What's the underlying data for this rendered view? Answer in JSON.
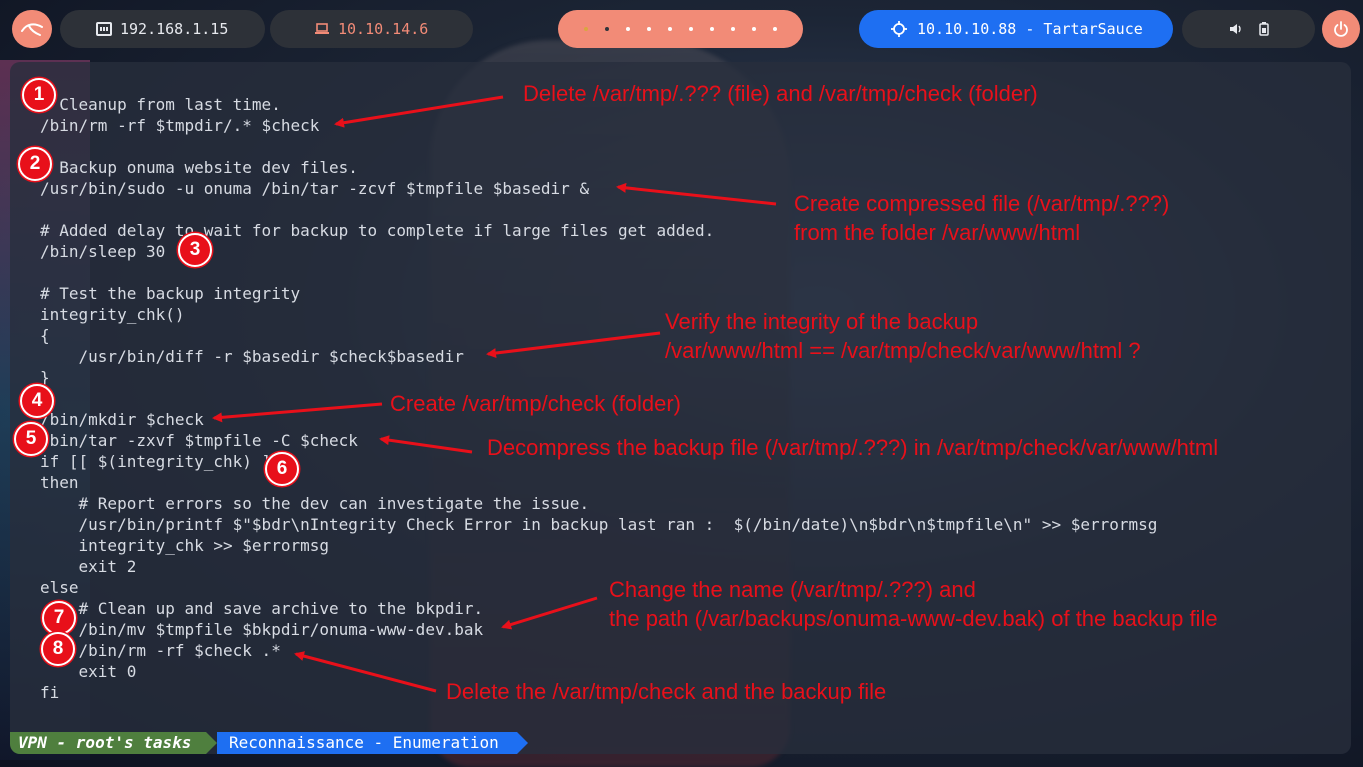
{
  "taskbar": {
    "ip_local": "192.168.1.15",
    "ip_vpn": "10.10.14.6",
    "target": "10.10.10.88 - TartarSauce"
  },
  "terminal": {
    "code_lines": [
      "# Cleanup from last time.",
      "/bin/rm -rf $tmpdir/.* $check",
      "",
      "# Backup onuma website dev files.",
      "/usr/bin/sudo -u onuma /bin/tar -zcvf $tmpfile $basedir &",
      "",
      "# Added delay to wait for backup to complete if large files get added.",
      "/bin/sleep 30",
      "",
      "# Test the backup integrity",
      "integrity_chk()",
      "{",
      "    /usr/bin/diff -r $basedir $check$basedir",
      "}",
      "",
      "/bin/mkdir $check",
      "/bin/tar -zxvf $tmpfile -C $check",
      "if [[ $(integrity_chk) ]]",
      "then",
      "    # Report errors so the dev can investigate the issue.",
      "    /usr/bin/printf $\"$bdr\\nIntegrity Check Error in backup last ran :  $(/bin/date)\\n$bdr\\n$tmpfile\\n\" >> $errormsg",
      "    integrity_chk >> $errormsg",
      "    exit 2",
      "else",
      "    # Clean up and save archive to the bkpdir.",
      "    /bin/mv $tmpfile $bkpdir/onuma-www-dev.bak",
      "    /bin/rm -rf $check .*",
      "    exit 0",
      "fi"
    ],
    "status_left": "VPN - root's tasks",
    "status_right": "Reconnaissance - Enumeration"
  },
  "annotations": {
    "badges": [
      "1",
      "2",
      "3",
      "4",
      "5",
      "6",
      "7",
      "8"
    ],
    "notes": {
      "delete_files": "Delete /var/tmp/.???   (file)    and     /var/tmp/check   (folder)",
      "compress_1": "Create compressed file (/var/tmp/.???)",
      "compress_2": "from the folder /var/www/html",
      "verify_1": "Verify the integrity of the backup",
      "verify_2": "/var/www/html   ==   /var/tmp/check/var/www/html ?",
      "create_check": "Create /var/tmp/check   (folder)",
      "decompress": "Decompress the backup file (/var/tmp/.???)   in   /var/tmp/check/var/www/html",
      "rename_1": "Change the name (/var/tmp/.???) and",
      "rename_2": "the path (/var/backups/onuma-www-dev.bak) of the backup file",
      "delete_check": "Delete the /var/tmp/check and the backup file"
    }
  },
  "colors": {
    "annotation": "#e8101a",
    "accent": "#f28b77",
    "target_blue": "#1e6ff2",
    "status_green": "#4f7f3e"
  },
  "icons": [
    "kali-dragon-icon",
    "ethernet-icon",
    "laptop-icon",
    "crosshair-icon",
    "speaker-icon",
    "battery-icon",
    "power-icon"
  ]
}
